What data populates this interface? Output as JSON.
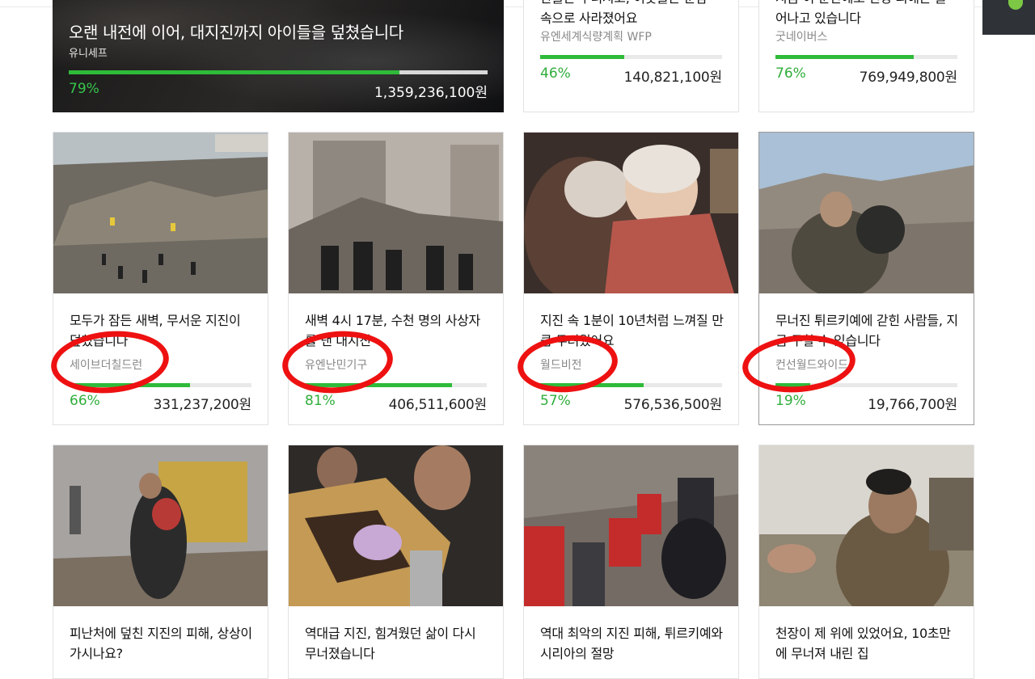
{
  "feature": {
    "title": "오랜 내전에 이어, 대지진까지 아이들을 덮쳤습니다",
    "org": "유니세프",
    "percent": "79%",
    "progress": 0.79,
    "amount": "1,359,236,100원"
  },
  "top_cards": [
    {
      "title_line1": "관들은 무너지고, 이웃들은 눈깜",
      "title_line2": "속으로 사라졌어요",
      "org": "유엔세계식량계획 WFP",
      "percent": "46%",
      "progress": 0.46,
      "amount": "140,821,100원"
    },
    {
      "title_line1": "지금 이 순간에도 긴장 피해는 늘",
      "title_line2": "어나고 있습니다",
      "org": "굿네이버스",
      "percent": "76%",
      "progress": 0.76,
      "amount": "769,949,800원"
    }
  ],
  "row2_cards": [
    {
      "title": "모두가 잠든 새벽, 무서운 지진이 덮쳤습니다",
      "org": "세이브더칠드런",
      "percent": "66%",
      "progress": 0.66,
      "amount": "331,237,200원",
      "image_desc": "rescue crowd among collapsed buildings"
    },
    {
      "title": "새벽 4시 17분, 수천 명의 사상자를 낸 대지진",
      "org": "유엔난민기구",
      "percent": "81%",
      "progress": 0.81,
      "amount": "406,511,600원",
      "image_desc": "people in front of collapsed building"
    },
    {
      "title": "지진 속 1분이 10년처럼 느껴질 만큼 두려웠어요",
      "org": "월드비전",
      "percent": "57%",
      "progress": 0.57,
      "amount": "576,536,500원",
      "image_desc": "injured child held by man"
    },
    {
      "title": "무너진 튀르키예에 갇힌 사람들, 지금 구할 수 있습니다",
      "org": "컨선월드와이드",
      "percent": "19%",
      "progress": 0.19,
      "amount": "19,766,700원",
      "image_desc": "men embracing near rubble"
    }
  ],
  "row3_cards": [
    {
      "title": "피난처에 덮친 지진의 피해, 상상이 가시나요?",
      "image_desc": "man carrying child near bulldozer"
    },
    {
      "title": "역대급 지진, 힘겨웠던 삶이 다시 무너졌습니다",
      "image_desc": "men holding child in blanket"
    },
    {
      "title": "역대 최악의 지진 피해, 튀르키예와 시리아의 절망",
      "image_desc": "red crescent rescuers in rubble"
    },
    {
      "title": "천장이 제 위에 있었어요, 10초만에 무너져 내린 집",
      "image_desc": "man covering face next to patient"
    }
  ],
  "colors": {
    "accent_green": "#2fbb3a",
    "highlight_red": "#ee1111",
    "dark_button": "#2f3338"
  }
}
